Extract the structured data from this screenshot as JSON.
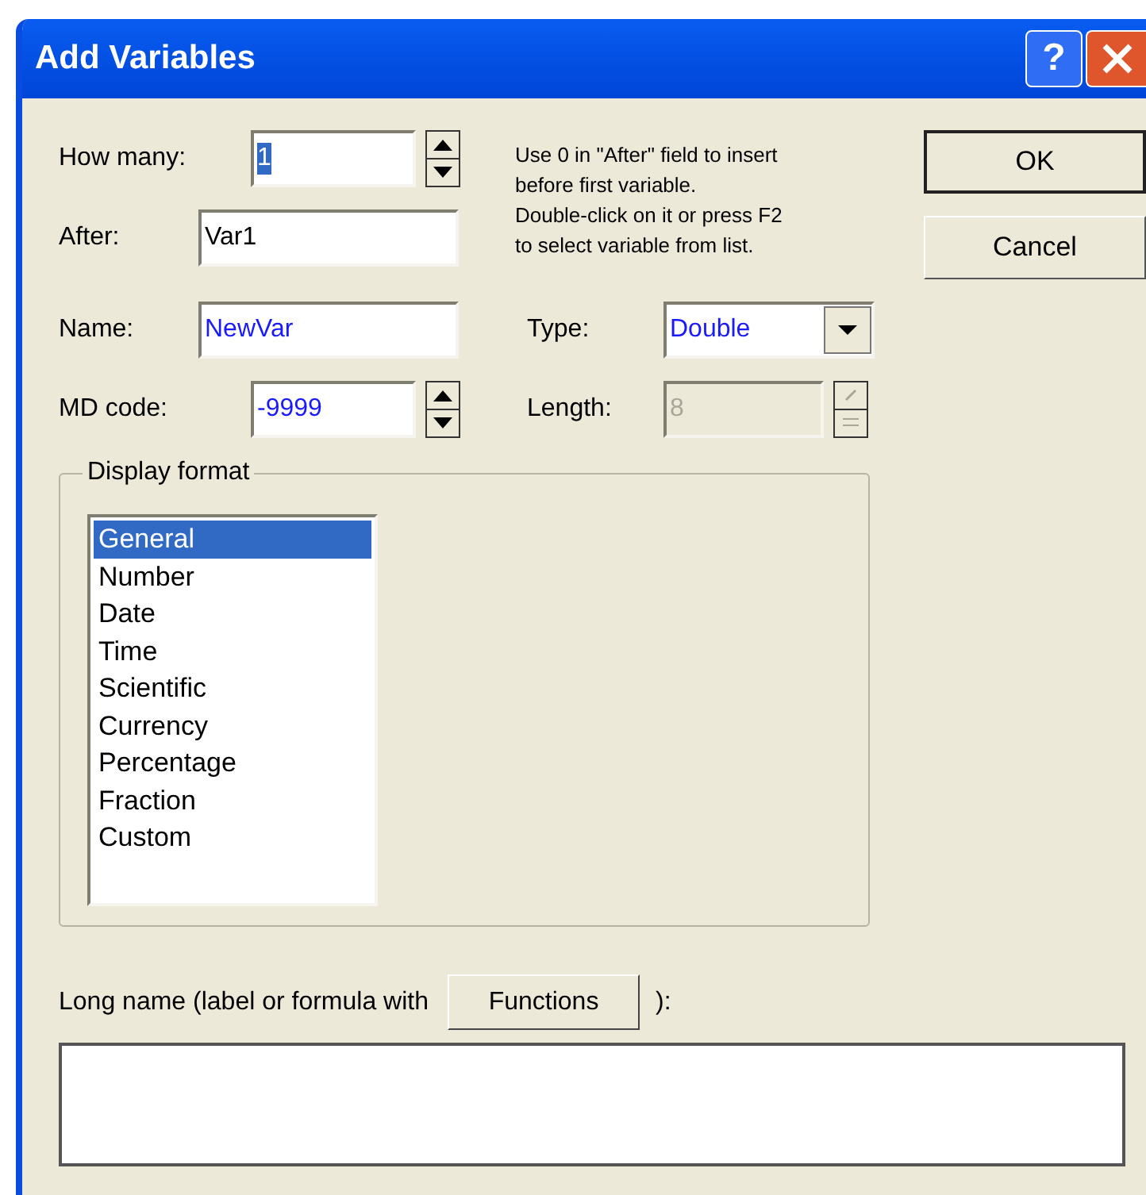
{
  "window": {
    "title": "Add Variables",
    "help_button": "?"
  },
  "fields": [
    {
      "kind": "spin",
      "label": "How many:",
      "value": "1",
      "text_selected": true,
      "changed": false,
      "disabled": false
    },
    {
      "kind": "text",
      "label": "After:",
      "value": "Var1",
      "text_selected": false,
      "changed": false,
      "disabled": false
    },
    {
      "kind": "text",
      "label": "Name:",
      "value": "NewVar",
      "text_selected": false,
      "changed": true,
      "disabled": false
    },
    {
      "kind": "combo",
      "label": "Type:",
      "value": "Double",
      "text_selected": false,
      "changed": true,
      "disabled": false
    },
    {
      "kind": "spin",
      "label": "MD code:",
      "value": "-9999",
      "text_selected": false,
      "changed": true,
      "disabled": false
    },
    {
      "kind": "spin",
      "label": "Length:",
      "value": "8",
      "text_selected": false,
      "changed": false,
      "disabled": true
    }
  ],
  "hint": [
    "Use 0 in \"After\" field to insert",
    "before first variable.",
    "Double-click on it or press F2",
    "to select variable from list."
  ],
  "buttons": [
    {
      "label": "OK",
      "default": true
    },
    {
      "label": "Cancel",
      "default": false
    }
  ],
  "display_format": {
    "title": "Display format",
    "items": [
      {
        "label": "General",
        "selected": true
      },
      {
        "label": "Number",
        "selected": false
      },
      {
        "label": "Date",
        "selected": false
      },
      {
        "label": "Time",
        "selected": false
      },
      {
        "label": "Scientific",
        "selected": false
      },
      {
        "label": "Currency",
        "selected": false
      },
      {
        "label": "Percentage",
        "selected": false
      },
      {
        "label": "Fraction",
        "selected": false
      },
      {
        "label": "Custom",
        "selected": false
      }
    ]
  },
  "long_name": {
    "label": "Long name (label or formula with",
    "button": "Functions",
    "suffix": "):"
  }
}
